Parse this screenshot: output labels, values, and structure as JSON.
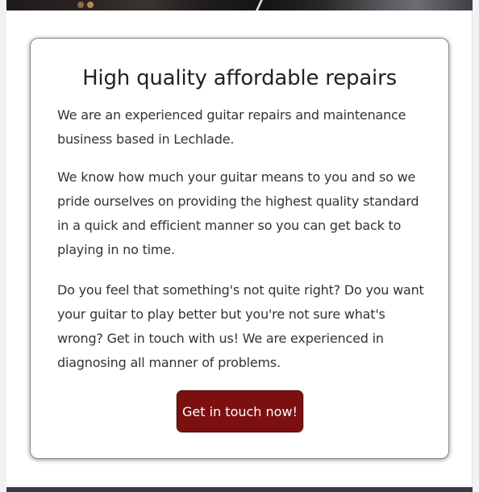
{
  "hero": {
    "image": "guitar-photo-banner"
  },
  "card": {
    "title": "High quality affordable repairs",
    "paragraphs": [
      "We are an experienced guitar repairs and maintenance business based in Lechlade.",
      "We know how much your guitar means to you and so we pride ourselves on providing the highest quality standard in a quick and efficient manner so you can get back to playing in no time.",
      "Do you feel that something's not quite right? Do you want your guitar to play better but you're not sure what's wrong? Get in touch with us! We are experienced in diagnosing all manner of problems."
    ],
    "cta_label": "Get in touch now!"
  },
  "colors": {
    "cta_background": "#7c1010",
    "footer_background": "#3a3a46",
    "title_text": "#222222",
    "body_text": "#333333"
  }
}
